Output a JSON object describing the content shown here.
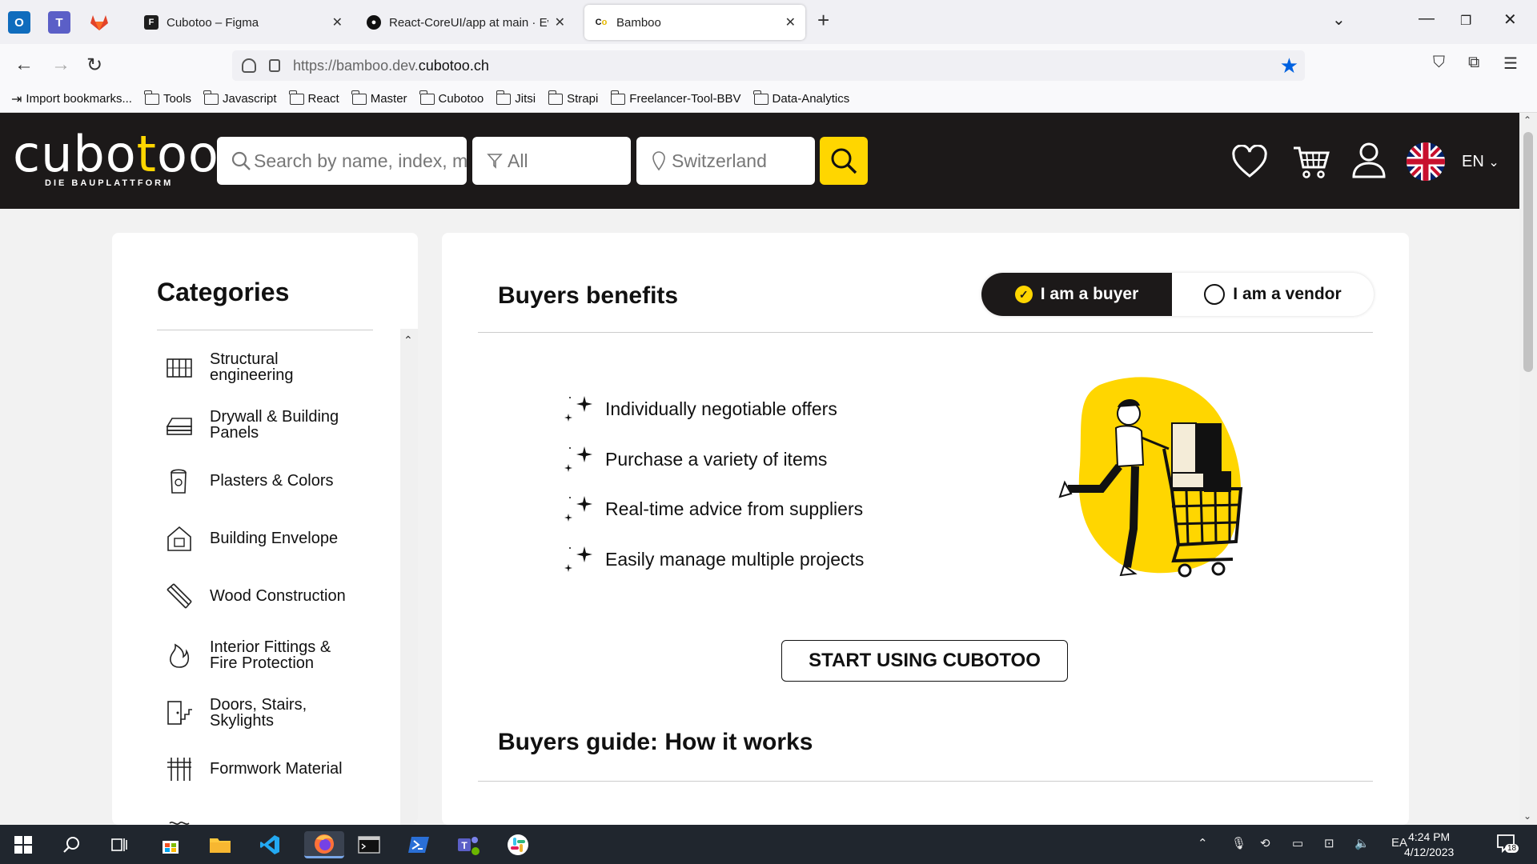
{
  "browser": {
    "tabs": [
      {
        "title": "Cubotoo – Figma",
        "active": false
      },
      {
        "title": "React-CoreUI/app at main · Eva",
        "active": false
      },
      {
        "title": "Bamboo",
        "active": true
      }
    ],
    "url_prefix": "https://bamboo.dev.",
    "url_domain": "cubotoo.ch",
    "bookmarks": [
      "Import bookmarks...",
      "Tools",
      "Javascript",
      "React",
      "Master",
      "Cubotoo",
      "Jitsi",
      "Strapi",
      "Freelancer-Tool-BBV",
      "Data-Analytics"
    ]
  },
  "header": {
    "logo_word_a": "cubo",
    "logo_word_b": "t",
    "logo_word_c": "oo",
    "logo_tagline": "DIE BAUPLATTFORM",
    "search_placeholder": "Search by name, index, m",
    "filter_value": "All",
    "location_value": "Switzerland",
    "language": "EN",
    "accent_color": "#ffd600",
    "header_color": "#1c1919"
  },
  "sidebar": {
    "title": "Categories",
    "items": [
      {
        "line1": "Structural",
        "line2": "engineering",
        "icon": "structural-icon"
      },
      {
        "line1": "Drywall & Building",
        "line2": "Panels",
        "icon": "drywall-icon"
      },
      {
        "line1": "Plasters & Colors",
        "line2": "",
        "icon": "paint-bucket-icon"
      },
      {
        "line1": "Building Envelope",
        "line2": "",
        "icon": "house-icon"
      },
      {
        "line1": "Wood Construction",
        "line2": "",
        "icon": "wood-planks-icon"
      },
      {
        "line1": "Interior Fittings &",
        "line2": "Fire Protection",
        "icon": "fire-icon"
      },
      {
        "line1": "Doors, Stairs,",
        "line2": "Skylights",
        "icon": "door-icon"
      },
      {
        "line1": "Formwork Material",
        "line2": "",
        "icon": "formwork-icon"
      }
    ]
  },
  "main": {
    "benefits_title": "Buyers benefits",
    "toggle_buyer": "I am a buyer",
    "toggle_vendor": "I am a vendor",
    "benefits": [
      "Individually negotiable offers",
      "Purchase a variety of items",
      "Real-time advice from suppliers",
      "Easily manage multiple projects"
    ],
    "cta_label": "START USING CUBOTOO",
    "guide_title": "Buyers guide: How it works"
  },
  "taskbar": {
    "time": "4:24 PM",
    "date": "4/12/2023",
    "input_lang": "EA",
    "notif_count": "18"
  }
}
